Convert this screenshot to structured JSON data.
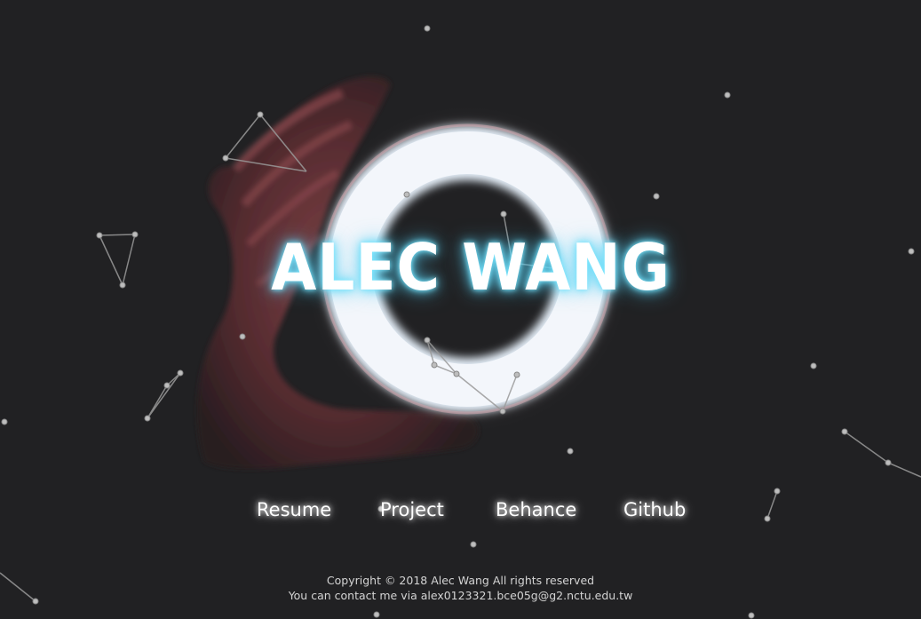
{
  "hero": {
    "title": "ALEC WANG"
  },
  "nav": {
    "links": [
      {
        "label": "Resume"
      },
      {
        "label": "Project"
      },
      {
        "label": "Behance"
      },
      {
        "label": "Github"
      }
    ]
  },
  "footer": {
    "copyright": "Copyright © 2018 Alec Wang All rights reserved",
    "contact": "You can contact me via alex0123321.bce05g@g2.nctu.edu.tw"
  },
  "colors": {
    "background": "#212123",
    "ring": "#e4eef8",
    "title_glow": "#5fd6f5",
    "hand": "#7a3e42"
  }
}
